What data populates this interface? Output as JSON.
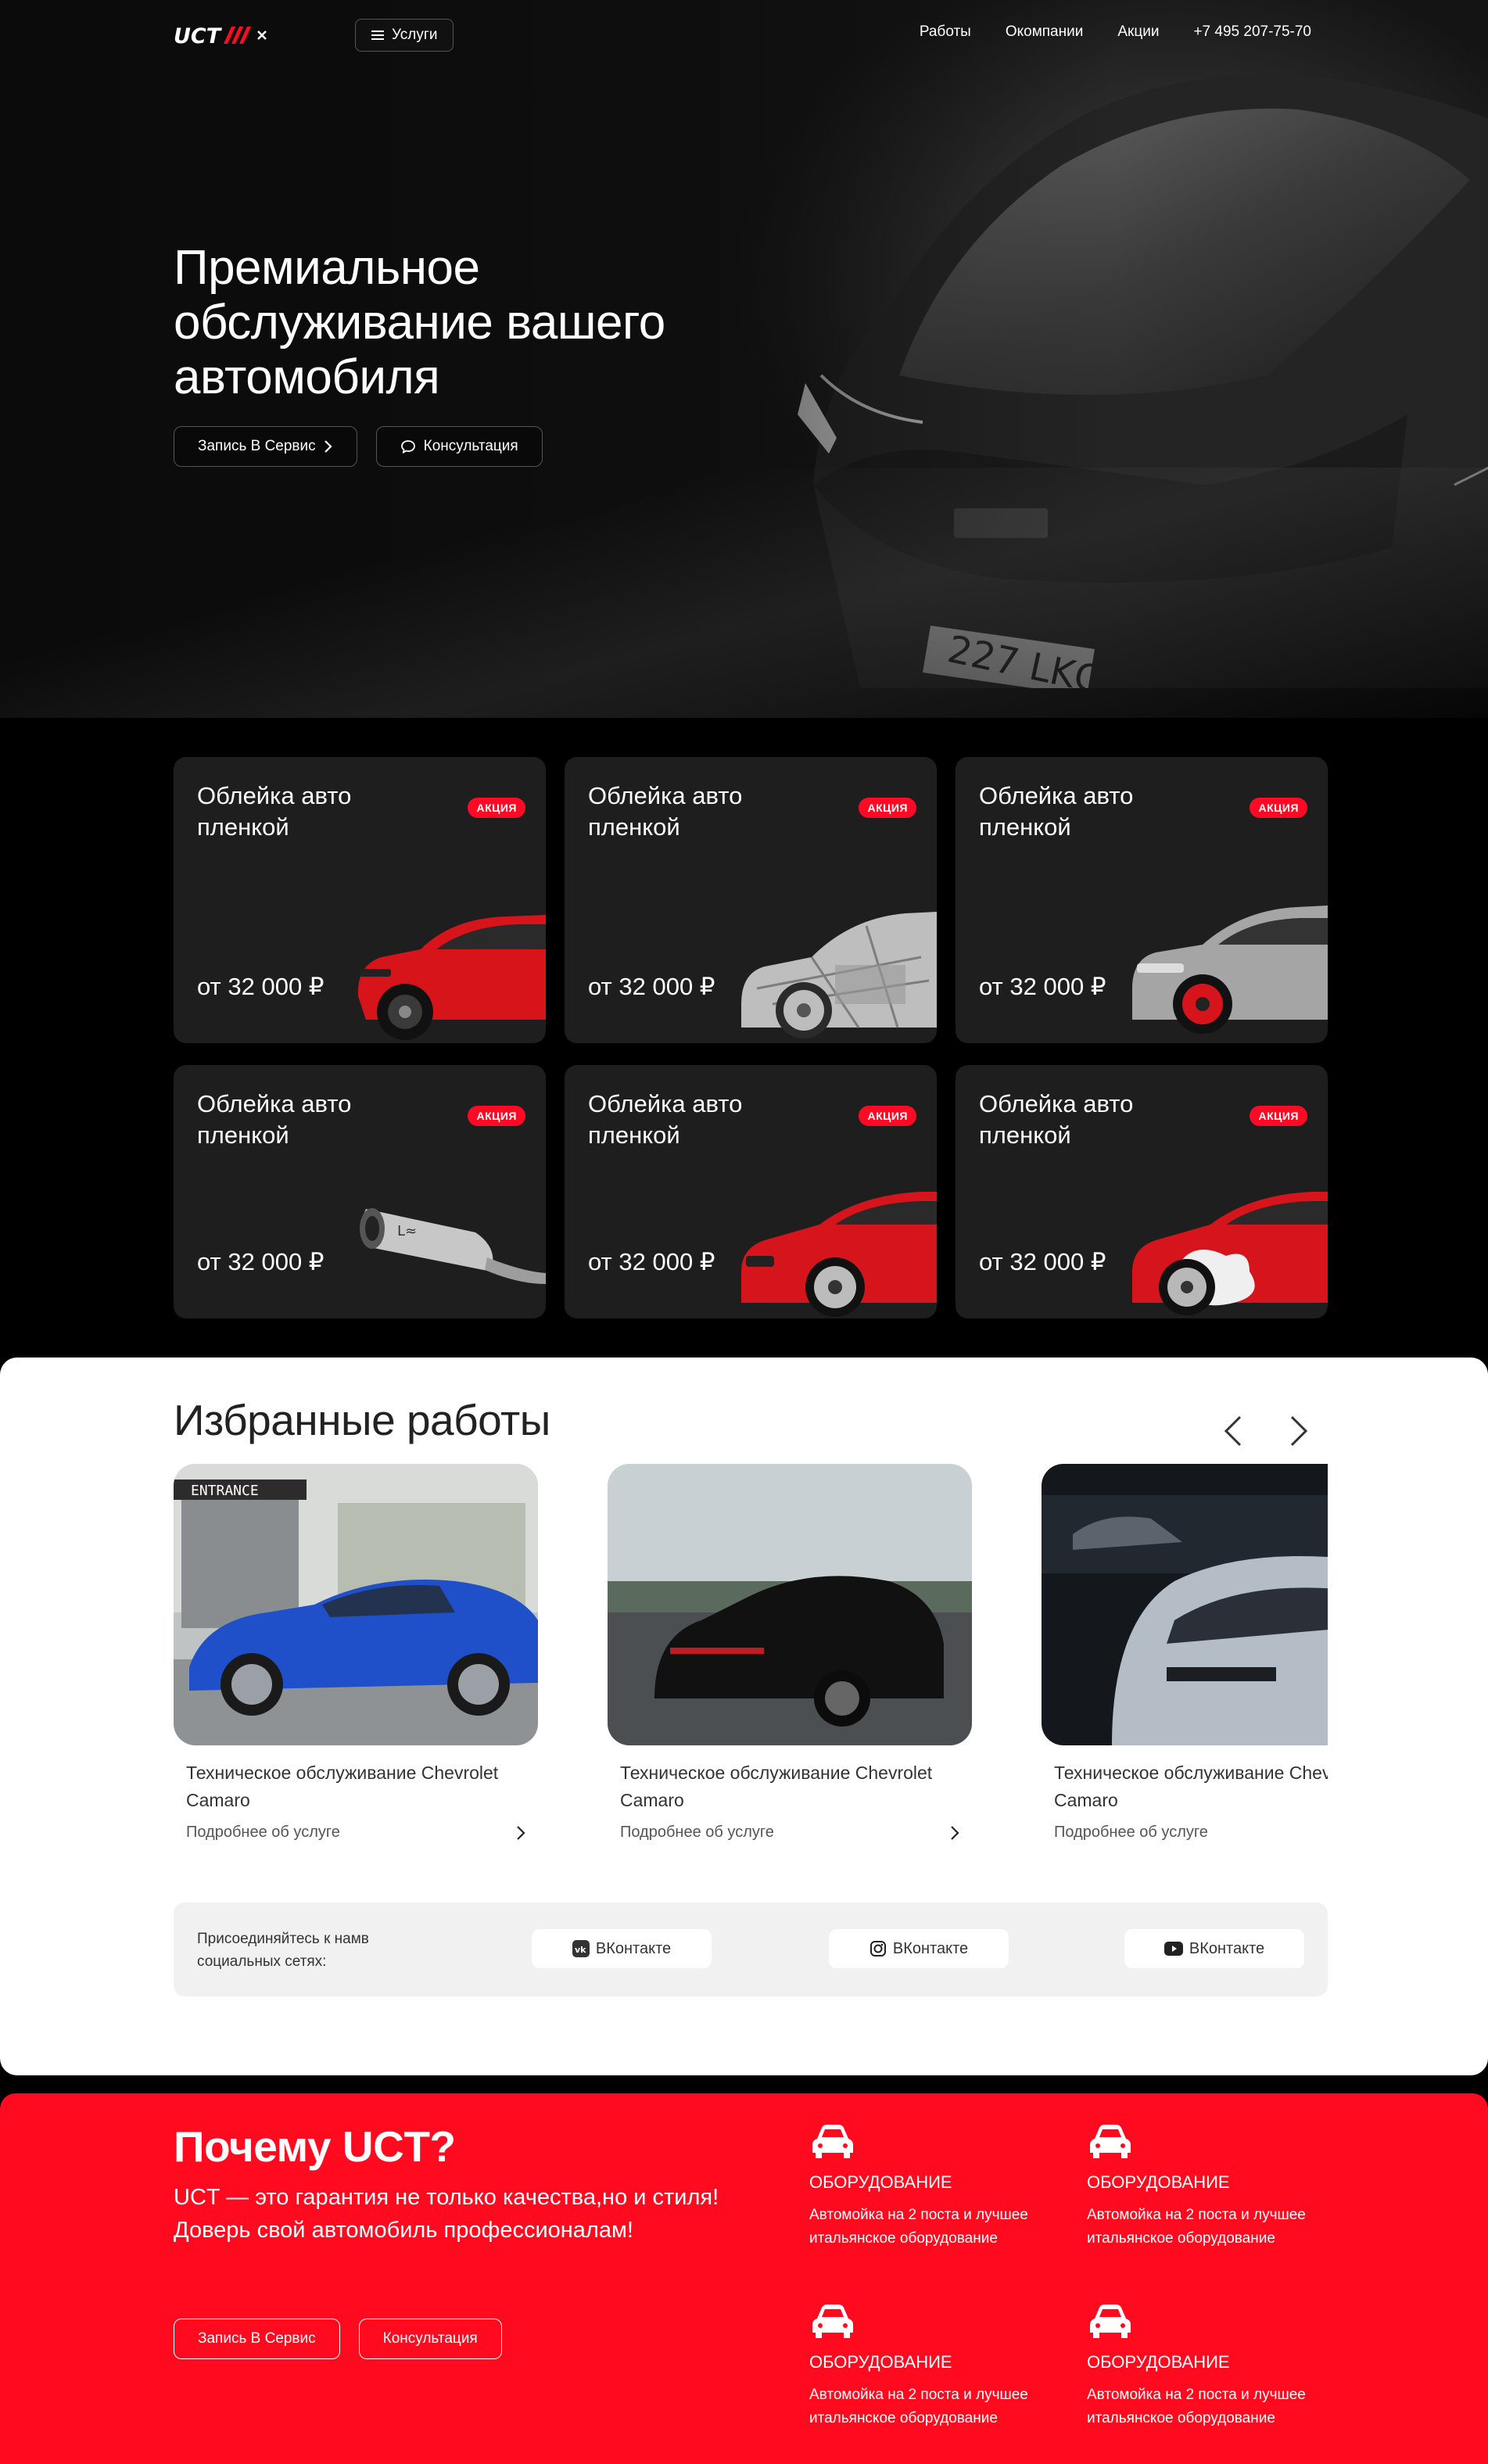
{
  "header": {
    "menu_label": "Услуги",
    "nav": [
      "Работы",
      "Окомпании",
      "Акции",
      "+7 495 207-75-70"
    ]
  },
  "hero": {
    "title": "Премиальное обслуживание вашего автомобиля",
    "btn_service": "Запись В Сервис",
    "btn_consult": "Консультация"
  },
  "cards": [
    {
      "title": "Облейка авто пленкой",
      "badge": "АКЦИЯ",
      "price": "от 32 000 ₽",
      "image": "red-suv"
    },
    {
      "title": "Облейка авто пленкой",
      "badge": "АКЦИЯ",
      "price": "от 32 000 ₽",
      "image": "xray-car"
    },
    {
      "title": "Облейка авто пленкой",
      "badge": "АКЦИЯ",
      "price": "от 32 000 ₽",
      "image": "grey-suv"
    },
    {
      "title": "Облейка авто пленкой",
      "badge": "АКЦИЯ",
      "price": "от 32 000 ₽",
      "image": "exhaust"
    },
    {
      "title": "Облейка авто пленкой",
      "badge": "АКЦИЯ",
      "price": "от 32 000 ₽",
      "image": "red-sedan"
    },
    {
      "title": "Облейка авто пленкой",
      "badge": "АКЦИЯ",
      "price": "от 32 000 ₽",
      "image": "red-sedan-foam"
    }
  ],
  "works": {
    "title": "Избранные работы",
    "items": [
      {
        "caption": "Техническое обслуживание Chevrolet Camaro",
        "more": "Подробнее об услуге"
      },
      {
        "caption": "Техническое обслуживание Chevrolet Camaro",
        "more": "Подробнее об услуге"
      },
      {
        "caption": "Техническое обслуживание Chevrolet Camaro",
        "more": "Подробнее об услуге"
      }
    ]
  },
  "social": {
    "lead": "Присоединяйтесь к намв социальных сетях:",
    "buttons": [
      {
        "label": "ВКонтакте",
        "icon": "vk-icon"
      },
      {
        "label": "ВКонтакте",
        "icon": "instagram-icon"
      },
      {
        "label": "ВКонтакте",
        "icon": "youtube-icon"
      }
    ]
  },
  "why": {
    "title": "Почему UCT?",
    "subtitle": "UCT — это гарантия не только качества,но и стиля! Доверь свой автомобиль профессионалам!",
    "btn_service": "Запись В Сервис",
    "btn_consult": "Консультация",
    "features": [
      {
        "title": "ОБОРУДОВАНИЕ",
        "desc": "Автомойка на 2 поста и лучшее итальянское оборудование"
      },
      {
        "title": "ОБОРУДОВАНИЕ",
        "desc": "Автомойка на 2 поста и лучшее итальянское оборудование"
      },
      {
        "title": "ОБОРУДОВАНИЕ",
        "desc": "Автомойка на 2 поста и лучшее итальянское оборудование"
      },
      {
        "title": "ОБОРУДОВАНИЕ",
        "desc": "Автомойка на 2 поста и лучшее итальянское оборудование"
      }
    ]
  },
  "colors": {
    "accent": "#ff0a24",
    "dark_card": "#1e1e1e",
    "bg": "#000000"
  }
}
